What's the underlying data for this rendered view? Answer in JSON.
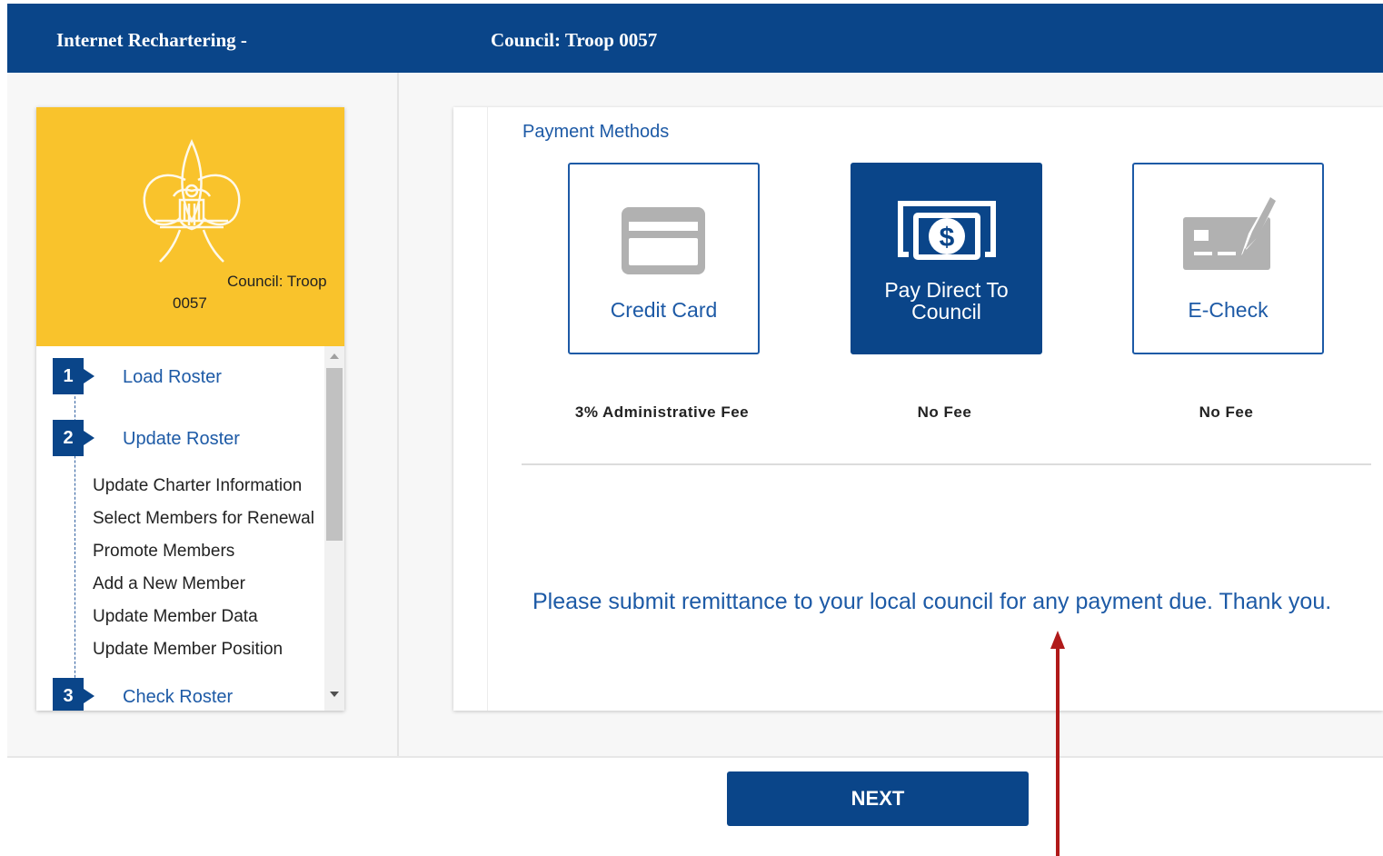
{
  "header": {
    "app_title": "Internet Rechartering -",
    "council_title": "Council: Troop 0057"
  },
  "sidebar": {
    "council_line1": "Council: Troop",
    "council_line2": "0057",
    "steps": [
      {
        "number": "1",
        "label": "Load Roster"
      },
      {
        "number": "2",
        "label": "Update Roster"
      },
      {
        "number": "3",
        "label": "Check Roster"
      }
    ],
    "sub_items": [
      "Update Charter Information",
      "Select Members for Renewal",
      "Promote Members",
      "Add a New Member",
      "Update Member Data",
      "Update Member Position"
    ]
  },
  "payment": {
    "section_title": "Payment Methods",
    "methods": [
      {
        "label": "Credit Card",
        "fee": "3% Administrative Fee",
        "icon": "credit-card-icon",
        "selected": false
      },
      {
        "label_line1": "Pay Direct To",
        "label_line2": "Council",
        "fee": "No Fee",
        "icon": "cash-bill-icon",
        "selected": true
      },
      {
        "label": "E-Check",
        "fee": "No Fee",
        "icon": "check-pen-icon",
        "selected": false
      }
    ],
    "message": "Please submit remittance to your local council for any payment due. Thank you."
  },
  "footer": {
    "next_label": "NEXT"
  },
  "colors": {
    "brand_blue": "#0a4589",
    "link_blue": "#1d5aa6",
    "hero_yellow": "#f9c32c",
    "annotation_red": "#b01a1a"
  }
}
